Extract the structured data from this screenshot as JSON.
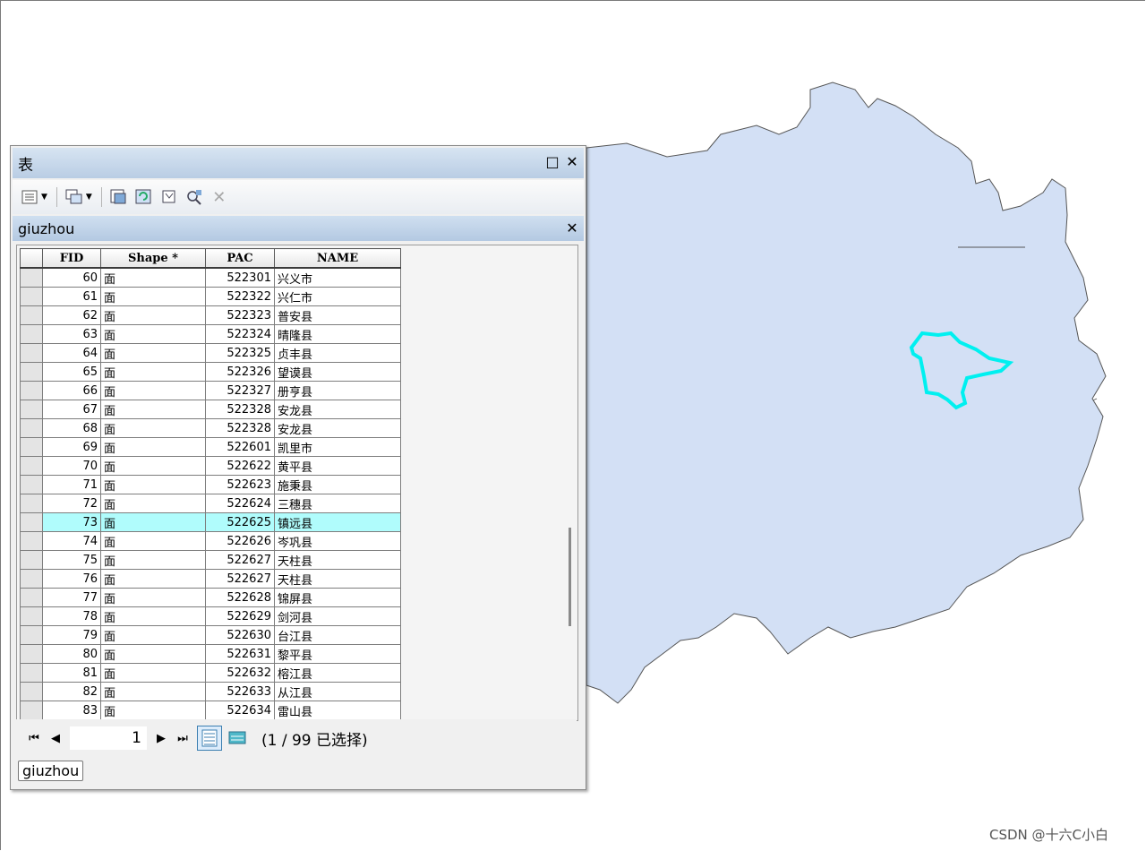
{
  "table_window": {
    "title": "表",
    "restore_label": "□",
    "close_label": "✕",
    "toolbar_icons": [
      "table-options-icon",
      "related-tables-icon",
      "select-by-attributes-icon",
      "switch-selection-icon",
      "clear-selection-icon",
      "zoom-to-selected-icon",
      "delete-selected-icon"
    ],
    "layer_tab": {
      "name": "giuzhou",
      "close_label": "✕"
    },
    "columns": [
      "FID",
      "Shape *",
      "PAC",
      "NAME"
    ],
    "rows": [
      {
        "fid": "60",
        "shape": "面",
        "pac": "522301",
        "name": "兴义市"
      },
      {
        "fid": "61",
        "shape": "面",
        "pac": "522322",
        "name": "兴仁市"
      },
      {
        "fid": "62",
        "shape": "面",
        "pac": "522323",
        "name": "普安县"
      },
      {
        "fid": "63",
        "shape": "面",
        "pac": "522324",
        "name": "晴隆县"
      },
      {
        "fid": "64",
        "shape": "面",
        "pac": "522325",
        "name": "贞丰县"
      },
      {
        "fid": "65",
        "shape": "面",
        "pac": "522326",
        "name": "望谟县"
      },
      {
        "fid": "66",
        "shape": "面",
        "pac": "522327",
        "name": "册亨县"
      },
      {
        "fid": "67",
        "shape": "面",
        "pac": "522328",
        "name": "安龙县"
      },
      {
        "fid": "68",
        "shape": "面",
        "pac": "522328",
        "name": "安龙县"
      },
      {
        "fid": "69",
        "shape": "面",
        "pac": "522601",
        "name": "凯里市"
      },
      {
        "fid": "70",
        "shape": "面",
        "pac": "522622",
        "name": "黄平县"
      },
      {
        "fid": "71",
        "shape": "面",
        "pac": "522623",
        "name": "施秉县"
      },
      {
        "fid": "72",
        "shape": "面",
        "pac": "522624",
        "name": "三穗县"
      },
      {
        "fid": "73",
        "shape": "面",
        "pac": "522625",
        "name": "镇远县",
        "highlighted": true
      },
      {
        "fid": "74",
        "shape": "面",
        "pac": "522626",
        "name": "岑巩县"
      },
      {
        "fid": "75",
        "shape": "面",
        "pac": "522627",
        "name": "天柱县"
      },
      {
        "fid": "76",
        "shape": "面",
        "pac": "522627",
        "name": "天柱县"
      },
      {
        "fid": "77",
        "shape": "面",
        "pac": "522628",
        "name": "锦屏县"
      },
      {
        "fid": "78",
        "shape": "面",
        "pac": "522629",
        "name": "剑河县"
      },
      {
        "fid": "79",
        "shape": "面",
        "pac": "522630",
        "name": "台江县"
      },
      {
        "fid": "80",
        "shape": "面",
        "pac": "522631",
        "name": "黎平县"
      },
      {
        "fid": "81",
        "shape": "面",
        "pac": "522632",
        "name": "榕江县"
      },
      {
        "fid": "82",
        "shape": "面",
        "pac": "522633",
        "name": "从江县"
      },
      {
        "fid": "83",
        "shape": "面",
        "pac": "522634",
        "name": "雷山县"
      }
    ],
    "nav": {
      "page": "1",
      "selection_text": "(1 / 99 已选择)"
    },
    "bottom_tab": "giuzhou"
  },
  "map": {
    "fill_color": "#d3e0f5",
    "stroke_color": "#555555",
    "highlight_color": "#00f0f0"
  },
  "watermark": "CSDN @十六C小白"
}
